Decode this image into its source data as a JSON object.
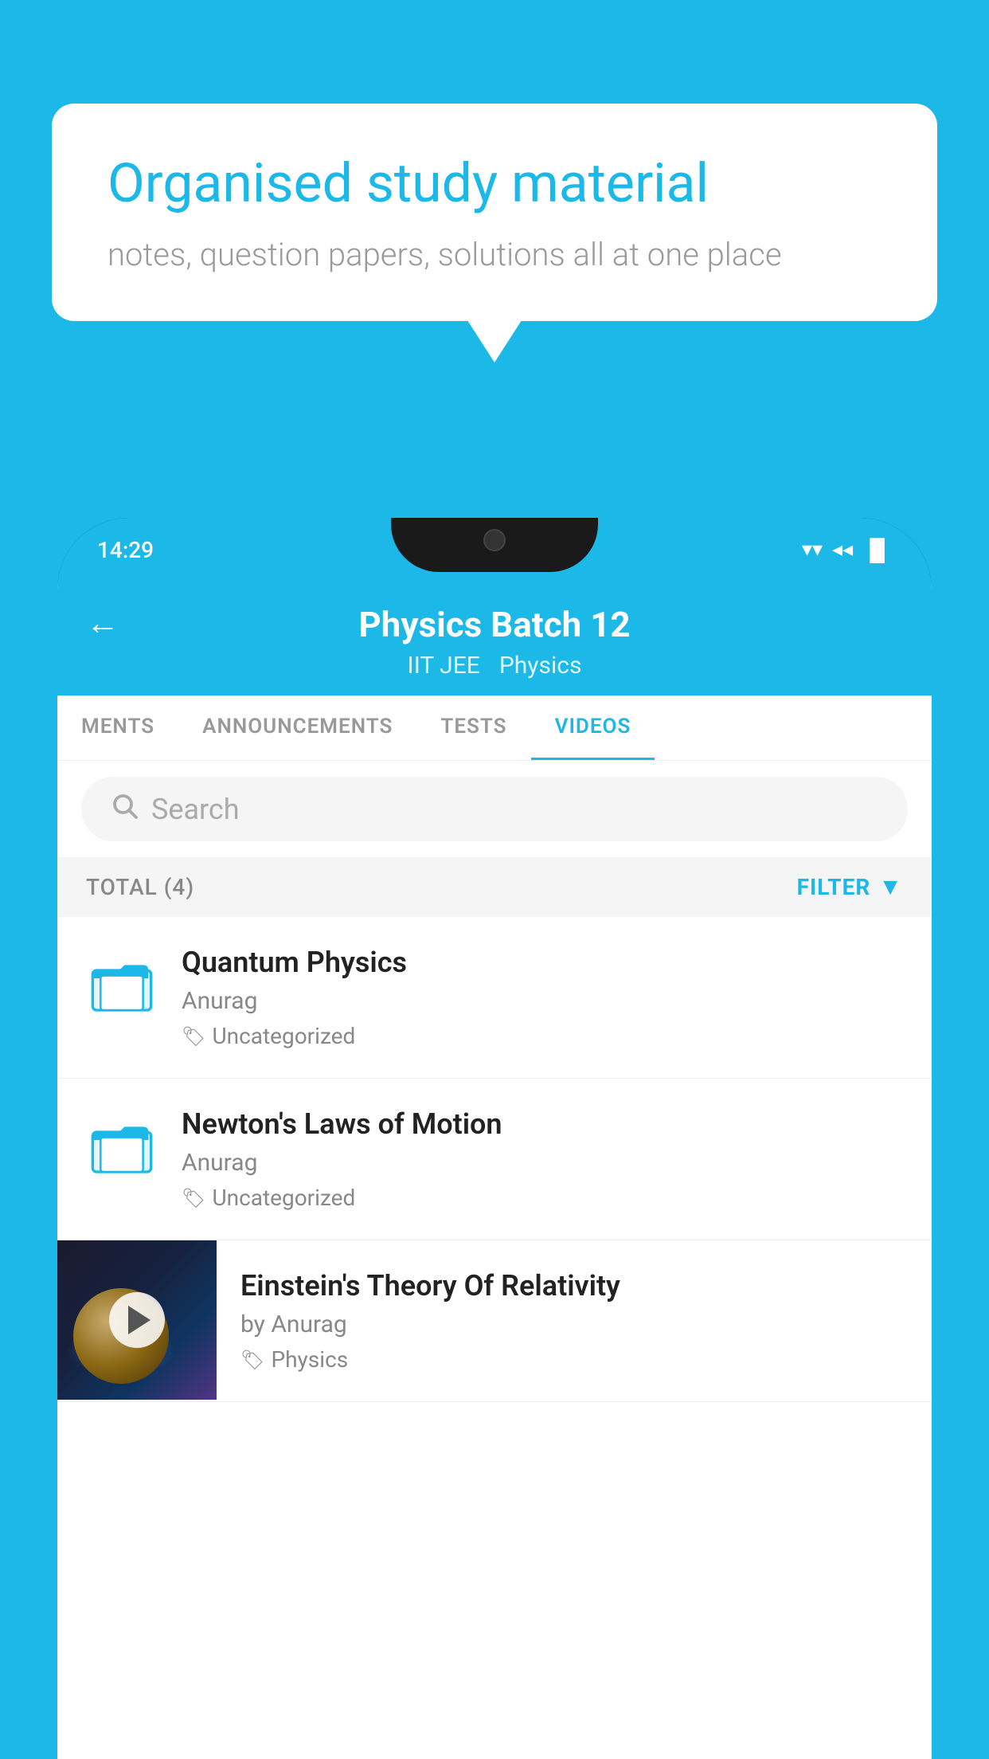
{
  "background_color": "#1bb8e8",
  "speech_bubble": {
    "heading": "Organised study material",
    "subtext": "notes, question papers, solutions all at one place"
  },
  "status_bar": {
    "time": "14:29",
    "wifi": "▼",
    "signal": "▲",
    "battery": "▌"
  },
  "header": {
    "title": "Physics Batch 12",
    "subtitle_left": "IIT JEE",
    "subtitle_right": "Physics",
    "back_label": "←"
  },
  "tabs": [
    {
      "label": "MENTS",
      "active": false
    },
    {
      "label": "ANNOUNCEMENTS",
      "active": false
    },
    {
      "label": "TESTS",
      "active": false
    },
    {
      "label": "VIDEOS",
      "active": true
    }
  ],
  "search": {
    "placeholder": "Search"
  },
  "filter_bar": {
    "total_label": "TOTAL (4)",
    "filter_label": "FILTER"
  },
  "videos": [
    {
      "id": 1,
      "title": "Quantum Physics",
      "author": "Anurag",
      "tag": "Uncategorized",
      "has_thumbnail": false
    },
    {
      "id": 2,
      "title": "Newton's Laws of Motion",
      "author": "Anurag",
      "tag": "Uncategorized",
      "has_thumbnail": false
    },
    {
      "id": 3,
      "title": "Einstein's Theory Of Relativity",
      "author": "by Anurag",
      "tag": "Physics",
      "has_thumbnail": true
    }
  ]
}
